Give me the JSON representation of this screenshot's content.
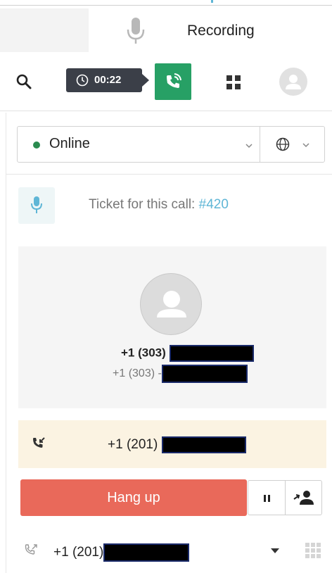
{
  "recording": {
    "label": "Recording",
    "icon": "microphone-icon"
  },
  "toolbar": {
    "search_icon": "search-icon",
    "timer": "00:22",
    "timer_icon": "clock-icon",
    "active_call_icon": "phone-ringing-icon",
    "apps_icon": "apps-grid-icon",
    "avatar_icon": "user-avatar-icon",
    "colors": {
      "timer_bg": "#3b3f48",
      "call_green": "#27a065"
    }
  },
  "status": {
    "value": "Online",
    "dot_color": "#2a8b4f",
    "language_icon": "globe-icon"
  },
  "ticket": {
    "prefix": "Ticket for this call: ",
    "link": "#420",
    "link_color": "#5fb6d6"
  },
  "contact": {
    "primary_number": "+1 (303)",
    "secondary_number": "+1 (303) -"
  },
  "incoming": {
    "number": "+1 (201)",
    "icon": "incoming-call-icon",
    "bg_color": "#fbf3e2"
  },
  "controls": {
    "hangup_label": "Hang up",
    "hangup_color": "#e9695a",
    "pause_icon": "pause-icon",
    "transfer_icon": "transfer-user-icon"
  },
  "outbound": {
    "number": "+1 (201)",
    "icon": "outgoing-call-icon",
    "dialpad_icon": "dialpad-icon"
  }
}
